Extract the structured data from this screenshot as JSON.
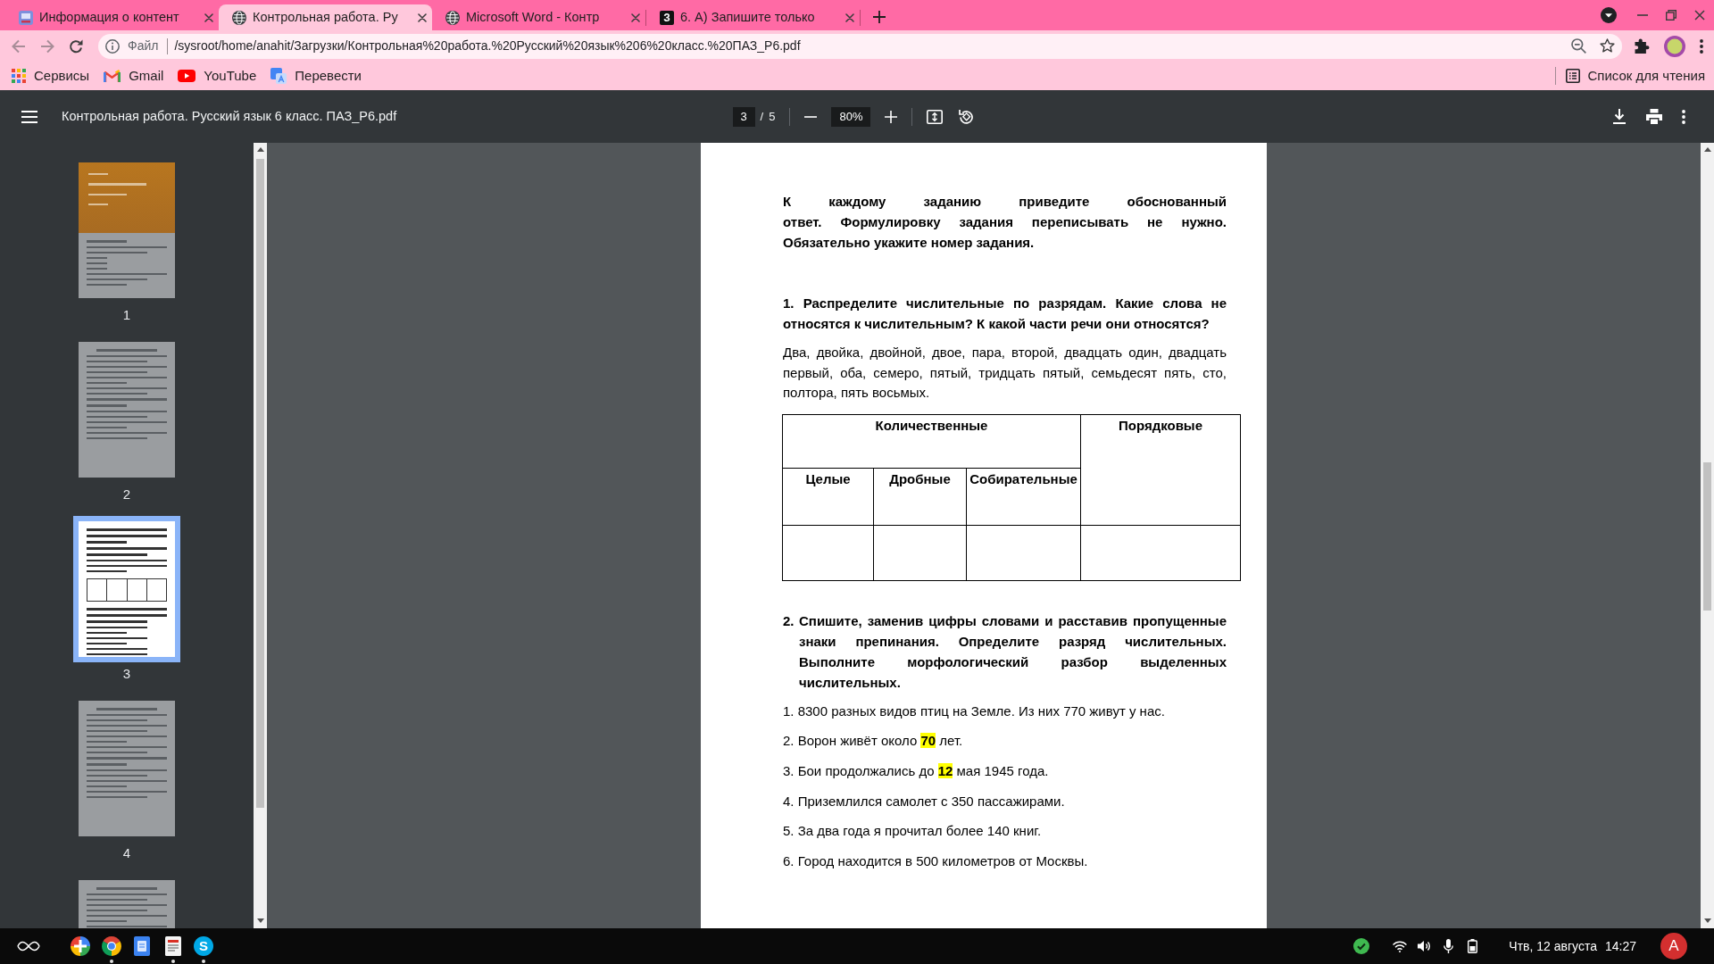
{
  "tabs": [
    {
      "kind": "tile",
      "title": "Информация о контент",
      "selected": false
    },
    {
      "kind": "globe",
      "title": "Контрольная работа. Ру",
      "selected": true
    },
    {
      "kind": "globe",
      "title": "Microsoft Word - Контр",
      "selected": false
    },
    {
      "kind": "letter",
      "favicon_letter": "З",
      "title": "6. А) Запишите только",
      "selected": false
    }
  ],
  "toolbar": {
    "nav_buttons": [
      {
        "kind": "back",
        "disabled": true
      },
      {
        "kind": "forward",
        "disabled": true
      },
      {
        "kind": "reload",
        "disabled": false
      }
    ],
    "address": {
      "scheme": "Файл",
      "url": "/sysroot/home/anahit/Загрузки/Контрольная%20работа.%20Русский%20язык%206%20класс.%20ПАЗ_Р6.pdf"
    }
  },
  "bookmarks": {
    "items": [
      {
        "kind": "apps",
        "label": "Сервисы"
      },
      {
        "kind": "mail",
        "label": "Gmail"
      },
      {
        "kind": "video",
        "label": "YouTube"
      },
      {
        "kind": "translate",
        "label": "Перевести"
      }
    ],
    "reading_list": "Список для чтения"
  },
  "pdf_toolbar": {
    "title": "Контрольная работа. Русский язык 6 класс. ПАЗ_Р6.pdf",
    "page": "3",
    "separator": "/",
    "page_count": "5",
    "zoom": "80%"
  },
  "sidebar": {
    "thumbnails": [
      {
        "kind": "cover",
        "label": "1",
        "selected": false
      },
      {
        "kind": "text",
        "label": "2",
        "selected": false
      },
      {
        "kind": "table",
        "label": "3",
        "selected": true
      },
      {
        "kind": "text",
        "label": "4",
        "selected": false
      },
      {
        "kind": "text",
        "selected": false
      }
    ]
  },
  "document": {
    "instructions": "К каждому заданию приведите обоснованный ответ. Формулировку задания переписывать не нужно. Обязательно укажите номер задания.",
    "task_1": {
      "heading": "1. Распределите числительные по разрядам. Какие слова не относятся к числительным? К какой части речи они относятся?",
      "words": "Два, двойка, двойной, двое, пара, второй, двадцать один, двадцать первый, оба, семеро, пятый, тридцать пятый, семьдесят пять, сто, полтора, пять восьмых.",
      "table": {
        "groups": [
          {
            "heading": "Количественные",
            "columns": [
              "Целые",
              "Дробные",
              "Собирательные"
            ]
          },
          {
            "heading": "Порядковые"
          }
        ]
      }
    },
    "task_2": {
      "number": "2.",
      "heading": "Спишите, заменив цифры словами и расставив пропущенные знаки препинания. Определите разряд числительных. Выполните морфологический разбор выделенных числительных.",
      "sentences": [
        "1. 8300 разных видов птиц на Земле. Из них 770 живут у нас.",
        "2. Ворон живёт около **70** лет.",
        "3. Бои продолжались до **12** мая 1945 года.",
        "4. Приземлился самолет с 350 пассажирами.",
        "5. За два года я прочитал более 140 книг.",
        "6. Город находится в 500 километров от Москвы."
      ]
    }
  },
  "taskbar": {
    "apps": [
      {
        "kind": "cross",
        "running": false
      },
      {
        "kind": "browser",
        "running": true
      },
      {
        "kind": "files",
        "running": false
      },
      {
        "kind": "document",
        "running": true
      },
      {
        "kind": "chat",
        "letter": "S",
        "running": true
      }
    ],
    "date": "Чтв, 12 августа",
    "time": "14:27",
    "user_initial": "A"
  }
}
